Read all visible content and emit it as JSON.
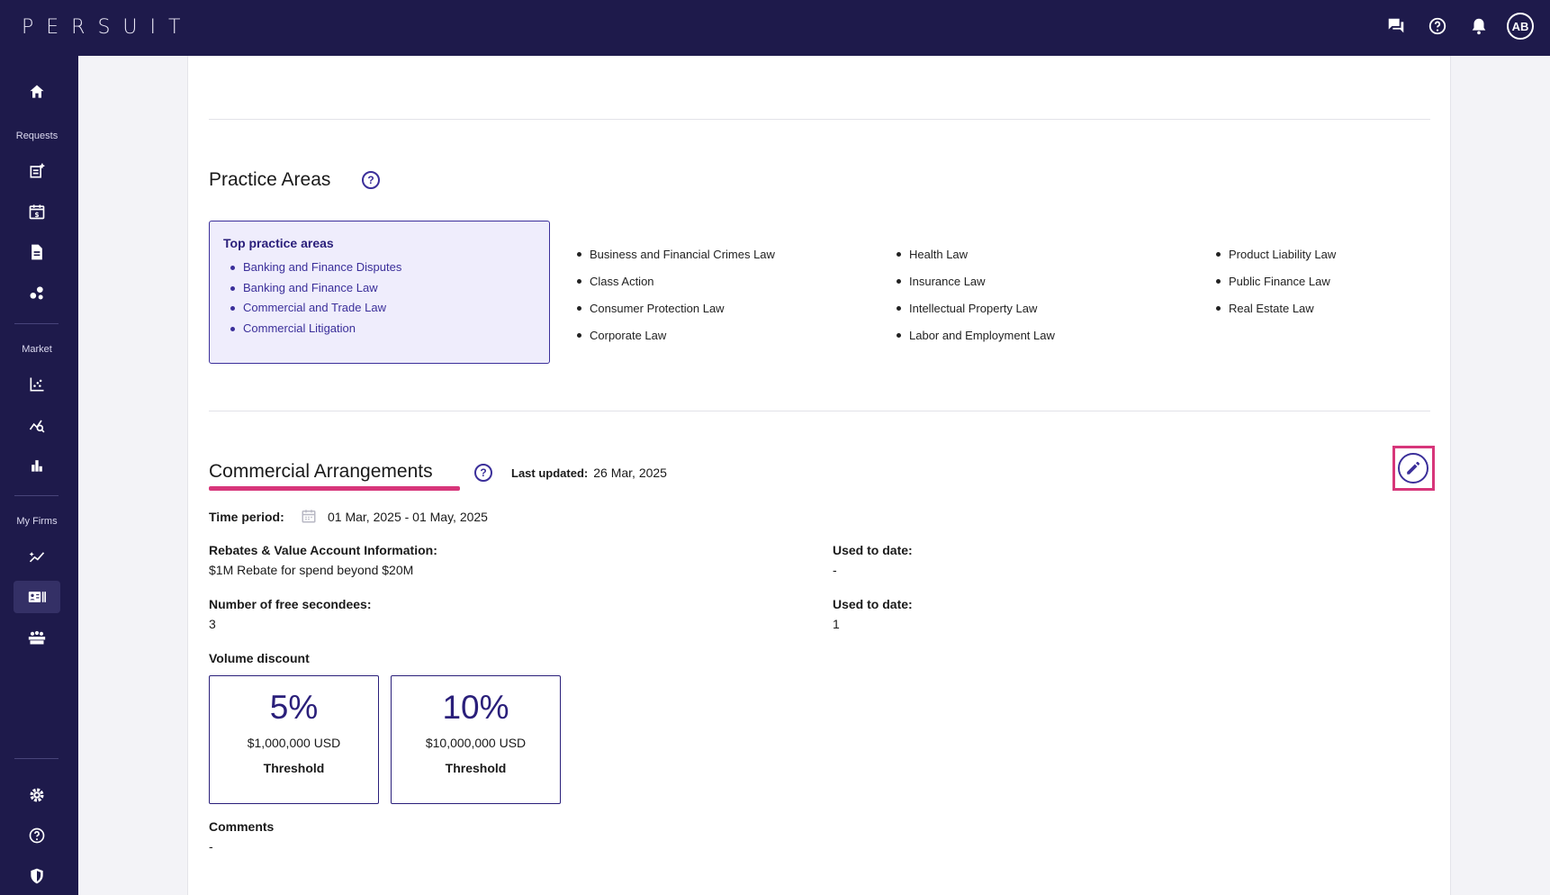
{
  "brand": {
    "logo_text": "PERSUIT"
  },
  "topbar": {
    "icons": [
      "chat-icon",
      "help-icon",
      "bell-icon"
    ],
    "avatar_initials": "AB"
  },
  "sidebar": {
    "sections": {
      "requests": "Requests",
      "market": "Market",
      "my_firms": "My Firms"
    },
    "items": [
      "home-icon",
      "new-request-icon",
      "calendar-dollar-icon",
      "document-icon",
      "network-icon",
      "scatter-chart-icon",
      "search-analytics-icon",
      "bar-chart-icon",
      "performance-icon",
      "firm-card-icon",
      "team-icon",
      "settings-icon",
      "help-icon",
      "shield-icon"
    ]
  },
  "practice_areas": {
    "title": "Practice Areas",
    "top_box": {
      "title": "Top practice areas",
      "items": [
        "Banking and Finance Disputes",
        "Banking and Finance Law",
        "Commercial and Trade Law",
        "Commercial Litigation"
      ]
    },
    "columns": [
      [
        "Business and Financial Crimes Law",
        "Class Action",
        "Consumer Protection Law",
        "Corporate Law"
      ],
      [
        "Health Law",
        "Insurance Law",
        "Intellectual Property Law",
        "Labor and Employment Law"
      ],
      [
        "Product Liability Law",
        "Public Finance Law",
        "Real Estate Law"
      ]
    ]
  },
  "commercial": {
    "title": "Commercial Arrangements",
    "last_updated_label": "Last updated:",
    "last_updated_value": "26 Mar, 2025",
    "time_period_label": "Time period:",
    "time_period_value": "01 Mar, 2025 - 01 May, 2025",
    "rebates_label": "Rebates & Value Account Information:",
    "rebates_value": "$1M Rebate for spend beyond $20M",
    "used1_label": "Used to date:",
    "used1_value": "-",
    "secondees_label": "Number of free secondees:",
    "secondees_value": "3",
    "used2_label": "Used to date:",
    "used2_value": "1",
    "volume_label": "Volume discount",
    "discounts": [
      {
        "pct": "5%",
        "amount": "$1,000,000 USD",
        "threshold": "Threshold"
      },
      {
        "pct": "10%",
        "amount": "$10,000,000 USD",
        "threshold": "Threshold"
      }
    ],
    "comments_label": "Comments",
    "comments_value": "-"
  },
  "colors": {
    "nav": "#1e1a4b",
    "accent": "#3b2f9a",
    "highlight": "#d7367a"
  }
}
